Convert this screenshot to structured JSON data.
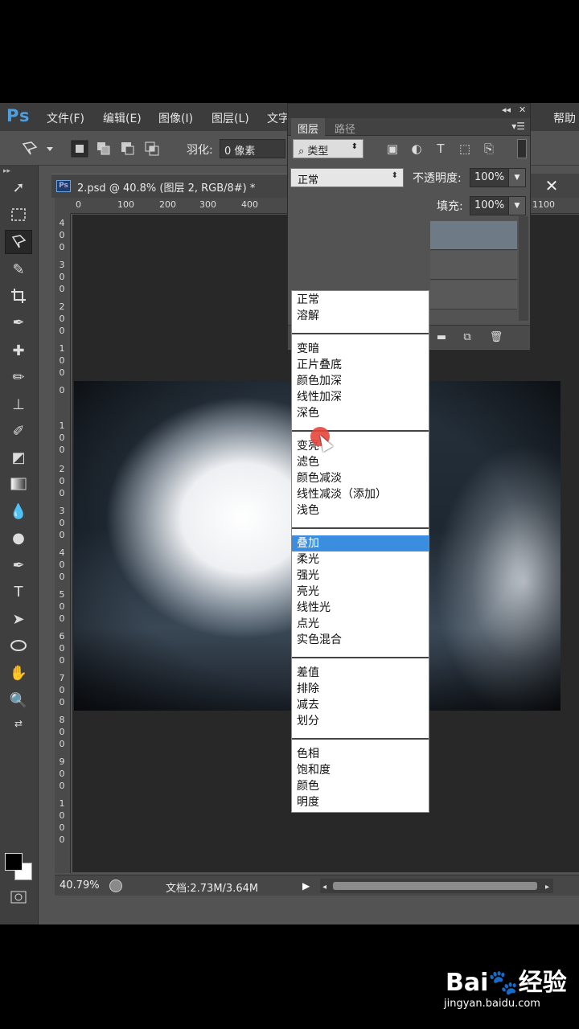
{
  "menubar": {
    "logo": "Ps",
    "items": [
      "文件(F)",
      "编辑(E)",
      "图像(I)",
      "图层(L)",
      "文字"
    ],
    "help": "帮助"
  },
  "options": {
    "feather_label": "羽化:",
    "feather_value": "0 像素"
  },
  "document": {
    "title": "2.psd @ 40.8% (图层 2, RGB/8#) *",
    "close": "✕",
    "ruler_top": [
      "0",
      "100",
      "200",
      "300",
      "400",
      "1100"
    ],
    "ruler_left": [
      "400",
      "300",
      "200",
      "100",
      "0",
      "100",
      "200",
      "300",
      "400",
      "500",
      "600",
      "700",
      "800",
      "900",
      "1000"
    ],
    "zoom": "40.79%",
    "doc_size": "文档:2.73M/3.64M"
  },
  "layers_panel": {
    "tabs": [
      "图层",
      "路径"
    ],
    "filter_kind": "类型",
    "blend_mode": "正常",
    "opacity_label": "不透明度:",
    "opacity_value": "100%",
    "fill_label": "填充:",
    "fill_value": "100%"
  },
  "blend_menu": {
    "groups": [
      [
        "正常",
        "溶解"
      ],
      [
        "变暗",
        "正片叠底",
        "颜色加深",
        "线性加深",
        "深色"
      ],
      [
        "变亮",
        "滤色",
        "颜色减淡",
        "线性减淡（添加）",
        "浅色"
      ],
      [
        "叠加",
        "柔光",
        "强光",
        "亮光",
        "线性光",
        "点光",
        "实色混合"
      ],
      [
        "差值",
        "排除",
        "减去",
        "划分"
      ],
      [
        "色相",
        "饱和度",
        "颜色",
        "明度"
      ]
    ],
    "selected": "叠加"
  },
  "watermark": {
    "logo": "Bai🐾经验",
    "url": "jingyan.baidu.com"
  }
}
